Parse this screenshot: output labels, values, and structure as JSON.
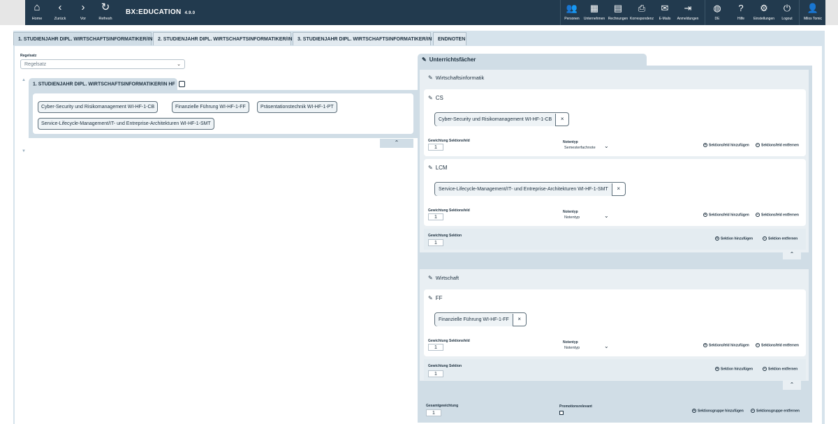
{
  "nav": {
    "home": "Home",
    "back": "Zurück",
    "forward": "Vor",
    "refresh": "Refresh",
    "brand": "BX:EDUCATION",
    "version": "4.9.0",
    "personen": "Personen",
    "unternehmen": "Unternehmen",
    "rechnungen": "Rechnungen",
    "korrespondenz": "Korrespondenz",
    "emails": "E-Mails",
    "anmeldungen": "Anmeldungen",
    "lang": "DE",
    "hilfe": "Hilfe",
    "einstellungen": "Einstellungen",
    "logout": "Logout",
    "user": "Milos Tomic"
  },
  "tabs": [
    "1. STUDIENJAHR DIPL. WIRTSCHAFTSINFORMATIKER/IN HF",
    "2. STUDIENJAHR DIPL. WIRTSCHAFTSINFORMATIKER/IN HF",
    "3. STUDIENJAHR DIPL. WIRTSCHAFTSINFORMATIKER/IN HF",
    "ENDNOTEN"
  ],
  "left": {
    "regelsatz_label": "Regelsatz",
    "regelsatz_value": "Regelsatz",
    "group_title": "1. STUDIENJAHR DIPL. WIRTSCHAFTSINFORMATIKER/IN HF",
    "chips": [
      "Cyber-Security und Risikomanagement WI-HF-1-CB",
      "Finanzielle Führung WI-HF-1-FF",
      "Präsentationstechnik WI-HF-1-PT",
      "Service-Lifecycle-Management/IT- und Entreprise-Architekturen WI-HF-1-SMT"
    ]
  },
  "right": {
    "title": "Unterrichtsfächer",
    "labels": {
      "gewichtung_sektionsfeld": "Gewichtung Sektionsfeld",
      "notentyp": "Notentyp",
      "gewichtung_sektion": "Gewichtung Sektion",
      "sektionsfeld_add": "Sektionsfeld hinzufügen",
      "sektionsfeld_remove": "Sektionsfeld entfernen",
      "sektion_add": "Sektion hinzufügen",
      "sektion_remove": "Sektion entfernen",
      "gesamtgewichtung": "Gesamtgewichtung",
      "promotionsrelevant": "Promotionsrelevant",
      "gruppe_add": "Sektionsgruppe hinzufügen",
      "gruppe_remove": "Sektionsgruppe entfernen"
    },
    "groups": [
      {
        "name": "Wirtschaftsinformatik",
        "sections": [
          {
            "name": "CS",
            "chip": "Cyber-Security und Risikomanagement WI-HF-1-CB",
            "weight": "1",
            "notentyp": "Semesterfachnote"
          },
          {
            "name": "LCM",
            "chip": "Service-Lifecycle-Management/IT- und Entreprise-Architekturen WI-HF-1-SMT",
            "weight": "1",
            "notentyp": "Notentyp"
          }
        ],
        "section_weight": "1"
      },
      {
        "name": "Wirtschaft",
        "sections": [
          {
            "name": "FF",
            "chip": "Finanzielle Führung WI-HF-1-FF",
            "weight": "1",
            "notentyp": "Notentyp"
          }
        ],
        "section_weight": "1"
      }
    ],
    "gesamt_value": "1"
  }
}
